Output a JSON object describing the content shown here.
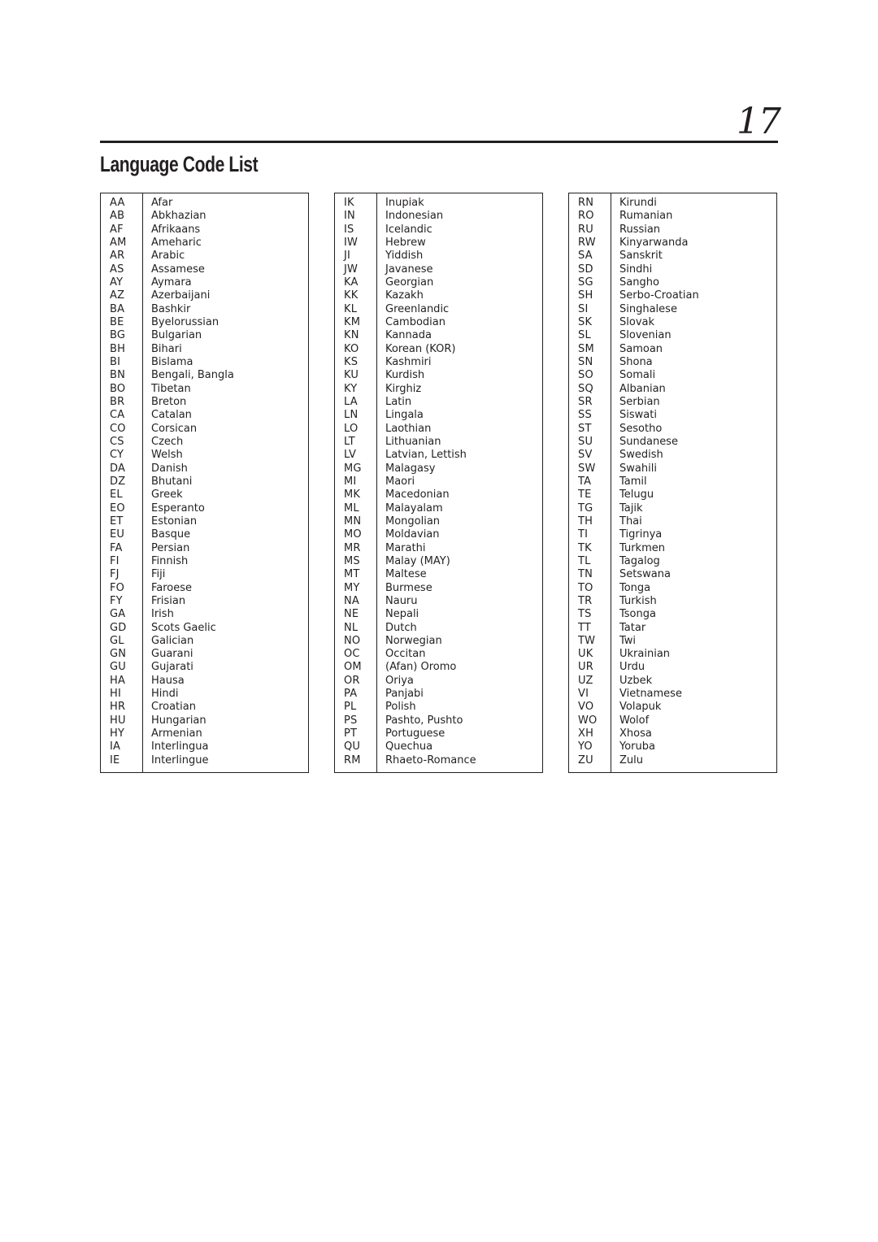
{
  "page": {
    "number": "17",
    "title": "Language Code List"
  },
  "tables": [
    {
      "rows": [
        {
          "code": "AA",
          "language": "Afar"
        },
        {
          "code": "AB",
          "language": "Abkhazian"
        },
        {
          "code": "AF",
          "language": "Afrikaans"
        },
        {
          "code": "AM",
          "language": "Ameharic"
        },
        {
          "code": "AR",
          "language": "Arabic"
        },
        {
          "code": "AS",
          "language": "Assamese"
        },
        {
          "code": "AY",
          "language": "Aymara"
        },
        {
          "code": "AZ",
          "language": "Azerbaijani"
        },
        {
          "code": "BA",
          "language": "Bashkir"
        },
        {
          "code": "BE",
          "language": "Byelorussian"
        },
        {
          "code": "BG",
          "language": "Bulgarian"
        },
        {
          "code": "BH",
          "language": "Bihari"
        },
        {
          "code": "BI",
          "language": "Bislama"
        },
        {
          "code": "BN",
          "language": "Bengali, Bangla"
        },
        {
          "code": "BO",
          "language": "Tibetan"
        },
        {
          "code": "BR",
          "language": "Breton"
        },
        {
          "code": "CA",
          "language": "Catalan"
        },
        {
          "code": "CO",
          "language": "Corsican"
        },
        {
          "code": "CS",
          "language": "Czech"
        },
        {
          "code": "CY",
          "language": "Welsh"
        },
        {
          "code": "DA",
          "language": "Danish"
        },
        {
          "code": "DZ",
          "language": "Bhutani"
        },
        {
          "code": "EL",
          "language": "Greek"
        },
        {
          "code": "EO",
          "language": "Esperanto"
        },
        {
          "code": "ET",
          "language": "Estonian"
        },
        {
          "code": "EU",
          "language": "Basque"
        },
        {
          "code": "FA",
          "language": "Persian"
        },
        {
          "code": "FI",
          "language": "Finnish"
        },
        {
          "code": "FJ",
          "language": "Fiji"
        },
        {
          "code": "FO",
          "language": "Faroese"
        },
        {
          "code": "FY",
          "language": "Frisian"
        },
        {
          "code": "GA",
          "language": "Irish"
        },
        {
          "code": "GD",
          "language": "Scots Gaelic"
        },
        {
          "code": "GL",
          "language": "Galician"
        },
        {
          "code": "GN",
          "language": "Guarani"
        },
        {
          "code": "GU",
          "language": "Gujarati"
        },
        {
          "code": "HA",
          "language": "Hausa"
        },
        {
          "code": "HI",
          "language": "Hindi"
        },
        {
          "code": "HR",
          "language": "Croatian"
        },
        {
          "code": "HU",
          "language": "Hungarian"
        },
        {
          "code": "HY",
          "language": "Armenian"
        },
        {
          "code": "IA",
          "language": "Interlingua"
        },
        {
          "code": "IE",
          "language": "Interlingue"
        }
      ]
    },
    {
      "rows": [
        {
          "code": "IK",
          "language": "Inupiak"
        },
        {
          "code": "IN",
          "language": "Indonesian"
        },
        {
          "code": "IS",
          "language": "Icelandic"
        },
        {
          "code": "IW",
          "language": "Hebrew"
        },
        {
          "code": "JI",
          "language": "Yiddish"
        },
        {
          "code": "JW",
          "language": "Javanese"
        },
        {
          "code": "KA",
          "language": "Georgian"
        },
        {
          "code": "KK",
          "language": "Kazakh"
        },
        {
          "code": "KL",
          "language": "Greenlandic"
        },
        {
          "code": "KM",
          "language": "Cambodian"
        },
        {
          "code": "KN",
          "language": "Kannada"
        },
        {
          "code": "KO",
          "language": "Korean (KOR)"
        },
        {
          "code": "KS",
          "language": "Kashmiri"
        },
        {
          "code": "KU",
          "language": "Kurdish"
        },
        {
          "code": "KY",
          "language": "Kirghiz"
        },
        {
          "code": "LA",
          "language": "Latin"
        },
        {
          "code": "LN",
          "language": "Lingala"
        },
        {
          "code": "LO",
          "language": "Laothian"
        },
        {
          "code": "LT",
          "language": "Lithuanian"
        },
        {
          "code": "LV",
          "language": "Latvian, Lettish"
        },
        {
          "code": "MG",
          "language": "Malagasy"
        },
        {
          "code": "MI",
          "language": "Maori"
        },
        {
          "code": "MK",
          "language": "Macedonian"
        },
        {
          "code": "ML",
          "language": "Malayalam"
        },
        {
          "code": "MN",
          "language": "Mongolian"
        },
        {
          "code": "MO",
          "language": "Moldavian"
        },
        {
          "code": "MR",
          "language": "Marathi"
        },
        {
          "code": "MS",
          "language": "Malay (MAY)"
        },
        {
          "code": "MT",
          "language": "Maltese"
        },
        {
          "code": "MY",
          "language": "Burmese"
        },
        {
          "code": "NA",
          "language": "Nauru"
        },
        {
          "code": "NE",
          "language": "Nepali"
        },
        {
          "code": "NL",
          "language": "Dutch"
        },
        {
          "code": "NO",
          "language": "Norwegian"
        },
        {
          "code": "OC",
          "language": "Occitan"
        },
        {
          "code": "OM",
          "language": "(Afan) Oromo"
        },
        {
          "code": "OR",
          "language": "Oriya"
        },
        {
          "code": "PA",
          "language": "Panjabi"
        },
        {
          "code": "PL",
          "language": "Polish"
        },
        {
          "code": "PS",
          "language": "Pashto, Pushto"
        },
        {
          "code": "PT",
          "language": "Portuguese"
        },
        {
          "code": "QU",
          "language": "Quechua"
        },
        {
          "code": "RM",
          "language": "Rhaeto-Romance"
        }
      ]
    },
    {
      "rows": [
        {
          "code": "RN",
          "language": "Kirundi"
        },
        {
          "code": "RO",
          "language": "Rumanian"
        },
        {
          "code": "RU",
          "language": "Russian"
        },
        {
          "code": "RW",
          "language": "Kinyarwanda"
        },
        {
          "code": "SA",
          "language": "Sanskrit"
        },
        {
          "code": "SD",
          "language": "Sindhi"
        },
        {
          "code": "SG",
          "language": "Sangho"
        },
        {
          "code": "SH",
          "language": "Serbo-Croatian"
        },
        {
          "code": "SI",
          "language": "Singhalese"
        },
        {
          "code": "SK",
          "language": "Slovak"
        },
        {
          "code": "SL",
          "language": "Slovenian"
        },
        {
          "code": "SM",
          "language": "Samoan"
        },
        {
          "code": "SN",
          "language": "Shona"
        },
        {
          "code": "SO",
          "language": "Somali"
        },
        {
          "code": "SQ",
          "language": "Albanian"
        },
        {
          "code": "SR",
          "language": "Serbian"
        },
        {
          "code": "SS",
          "language": "Siswati"
        },
        {
          "code": "ST",
          "language": "Sesotho"
        },
        {
          "code": "SU",
          "language": "Sundanese"
        },
        {
          "code": "SV",
          "language": "Swedish"
        },
        {
          "code": "SW",
          "language": "Swahili"
        },
        {
          "code": "TA",
          "language": "Tamil"
        },
        {
          "code": "TE",
          "language": "Telugu"
        },
        {
          "code": "TG",
          "language": "Tajik"
        },
        {
          "code": "TH",
          "language": "Thai"
        },
        {
          "code": "TI",
          "language": "Tigrinya"
        },
        {
          "code": "TK",
          "language": "Turkmen"
        },
        {
          "code": "TL",
          "language": "Tagalog"
        },
        {
          "code": "TN",
          "language": "Setswana"
        },
        {
          "code": "TO",
          "language": "Tonga"
        },
        {
          "code": "TR",
          "language": "Turkish"
        },
        {
          "code": "TS",
          "language": "Tsonga"
        },
        {
          "code": "TT",
          "language": "Tatar"
        },
        {
          "code": "TW",
          "language": "Twi"
        },
        {
          "code": "UK",
          "language": "Ukrainian"
        },
        {
          "code": "UR",
          "language": "Urdu"
        },
        {
          "code": "UZ",
          "language": "Uzbek"
        },
        {
          "code": "VI",
          "language": "Vietnamese"
        },
        {
          "code": "VO",
          "language": "Volapuk"
        },
        {
          "code": "WO",
          "language": "Wolof"
        },
        {
          "code": "XH",
          "language": "Xhosa"
        },
        {
          "code": "YO",
          "language": "Yoruba"
        },
        {
          "code": "ZU",
          "language": "Zulu"
        }
      ]
    }
  ]
}
